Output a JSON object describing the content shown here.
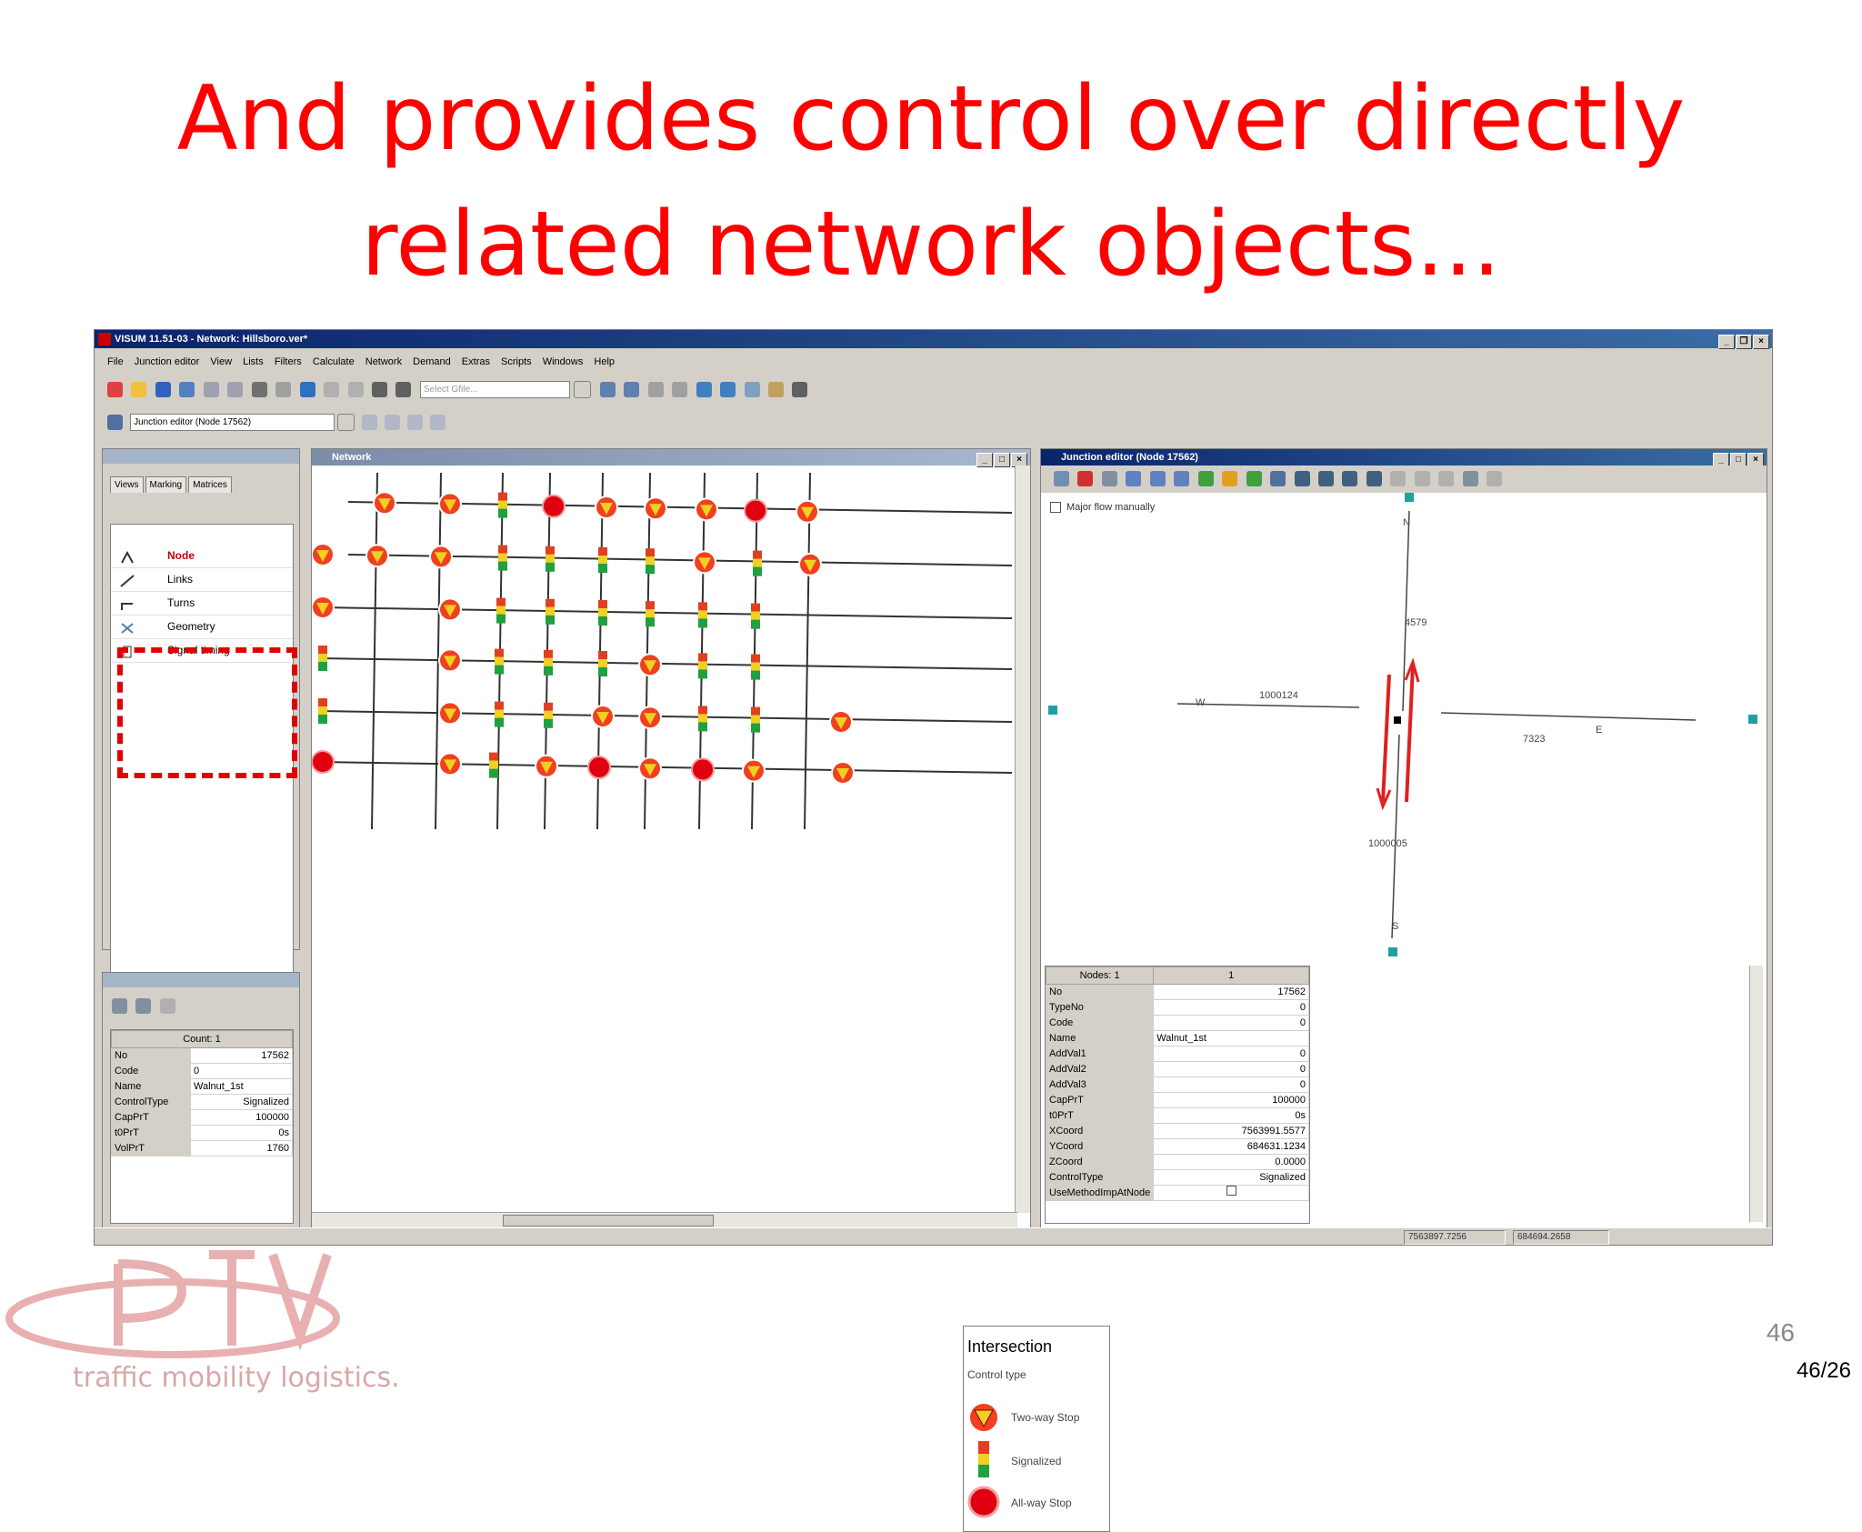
{
  "slide": {
    "title_line1": "And provides control over directly",
    "title_line2": "related network objects...",
    "page_number": "46",
    "page_count": "46/26",
    "logo_text": "traffic mobility logistics."
  },
  "window": {
    "title": "VISUM 11.51-03 - Network: Hillsboro.ver*",
    "menu": [
      "File",
      "Junction editor",
      "View",
      "Lists",
      "Filters",
      "Calculate",
      "Network",
      "Demand",
      "Extras",
      "Scripts",
      "Windows",
      "Help"
    ],
    "toolbar_combo": "Junction editor (Node 17562)",
    "select_combo": "Select Gfile..."
  },
  "left_panel": {
    "tabs": [
      "Views",
      "Marking",
      "Matrices"
    ],
    "nav_items": [
      "Node",
      "Links",
      "Turns",
      "Geometry",
      "Signal timing"
    ]
  },
  "quick_view": {
    "header": "Count: 1",
    "rows": [
      {
        "k": "No",
        "v": "17562"
      },
      {
        "k": "Code",
        "v": "0"
      },
      {
        "k": "Name",
        "v": "Walnut_1st"
      },
      {
        "k": "ControlType",
        "v": "Signalized"
      },
      {
        "k": "CapPrT",
        "v": "100000"
      },
      {
        "k": "t0PrT",
        "v": "0s"
      },
      {
        "k": "VolPrT",
        "v": "1760"
      }
    ]
  },
  "network_window": {
    "title": "Network",
    "legend": {
      "title": "Intersection",
      "subtitle": "Control type",
      "items": [
        "Two-way Stop",
        "Signalized",
        "All-way Stop"
      ]
    }
  },
  "junction_editor": {
    "title": "Junction editor (Node 17562)",
    "checkbox_label": "Major flow manually",
    "labels": {
      "n": "N",
      "s": "S",
      "w": "W",
      "e": "E",
      "north_link": "4579",
      "west_link": "1000124",
      "east_link": "7323",
      "south_link": "1000005"
    },
    "grid_header": [
      "Nodes: 1",
      "1"
    ],
    "rows": [
      {
        "k": "No",
        "v": "17562"
      },
      {
        "k": "TypeNo",
        "v": "0"
      },
      {
        "k": "Code",
        "v": "0"
      },
      {
        "k": "Name",
        "v": "Walnut_1st"
      },
      {
        "k": "AddVal1",
        "v": "0"
      },
      {
        "k": "AddVal2",
        "v": "0"
      },
      {
        "k": "AddVal3",
        "v": "0"
      },
      {
        "k": "CapPrT",
        "v": "100000"
      },
      {
        "k": "t0PrT",
        "v": "0s"
      },
      {
        "k": "XCoord",
        "v": "7563991.5577"
      },
      {
        "k": "YCoord",
        "v": "684631.1234"
      },
      {
        "k": "ZCoord",
        "v": "0.0000"
      },
      {
        "k": "ControlType",
        "v": "Signalized"
      },
      {
        "k": "UseMethodImpAtNode",
        "v": ""
      }
    ]
  },
  "status": {
    "x": "7563897.7256",
    "y": "684694.2658"
  },
  "colors": {
    "title_red": "#ff0000",
    "highlight": "#e00000"
  }
}
